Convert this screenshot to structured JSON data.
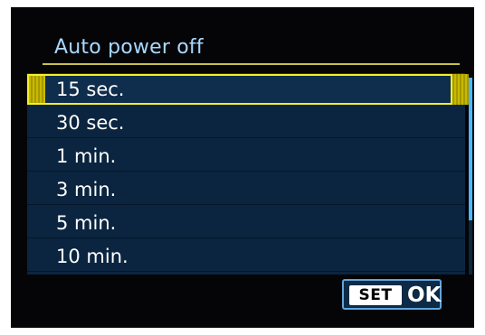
{
  "menu": {
    "title": "Auto power off",
    "selected_index": 0,
    "items": [
      {
        "label": "15 sec."
      },
      {
        "label": "30 sec."
      },
      {
        "label": "1 min."
      },
      {
        "label": "3 min."
      },
      {
        "label": "5 min."
      },
      {
        "label": "10 min."
      }
    ]
  },
  "confirm": {
    "set_label": "SET",
    "ok_label": "OK"
  },
  "colors": {
    "accent_title": "#a9d8ff",
    "selection": "#f4ef2b",
    "list_background": "#0b2540",
    "scroll_thumb": "#49b9ff"
  }
}
